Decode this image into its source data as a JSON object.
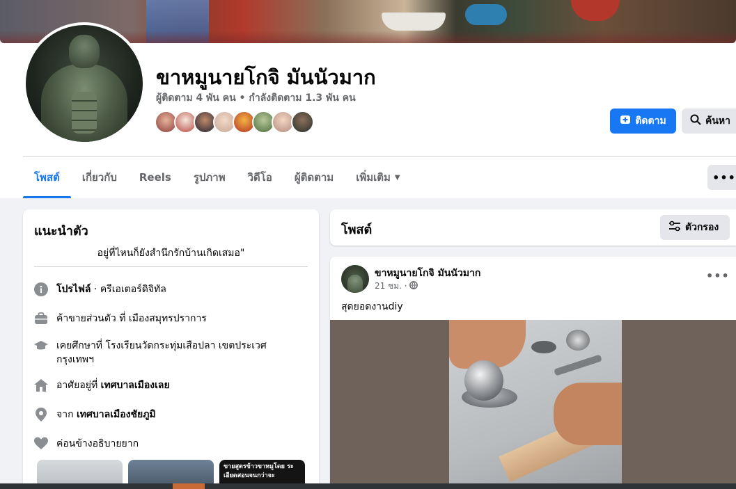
{
  "page": {
    "name": "ขาหมูนายโกจิ มันนัวมาก",
    "followers": "ผู้ติดตาม 4 พัน คน • กำลังติดตาม 1.3 พัน คน"
  },
  "buttons": {
    "follow": "ติดตาม",
    "search": "ค้นหา",
    "more": "•••"
  },
  "tabs": [
    {
      "label": "โพสต์"
    },
    {
      "label": "เกี่ยวกับ"
    },
    {
      "label": "Reels"
    },
    {
      "label": "รูปภาพ"
    },
    {
      "label": "วิดีโอ"
    },
    {
      "label": "ผู้ติดตาม"
    },
    {
      "label": "เพิ่มเติม"
    }
  ],
  "intro": {
    "title": "แนะนำตัว",
    "bio": "อยู่ที่ไหนก็ยังสำนึกรักบ้านเกิดเสมอ\"",
    "profile_label": "โปรไฟล์",
    "profile_value": " · ครีเอเตอร์ดิจิทัล",
    "work": "ค้าขายส่วนตัว ที่ เมืองสมุทรปราการ",
    "education": "เคยศึกษาที่ โรงเรียนวัดกระทุ่มเสือปลา เขตประเวศ กรุงเทพฯ",
    "lives_prefix": "อาศัยอยู่ที่ ",
    "lives_place": "เทศบาลเมืองเลย",
    "from_prefix": "จาก ",
    "from_place": "เทศบาลเมืองชัยภูมิ",
    "relationship": "ค่อนข้างอธิบายยาก",
    "photo3_text": "ขายสูตรข้าวขาหมูโดย ระเอียดสอนจนกว่าจะ"
  },
  "posts": {
    "title": "โพสต์",
    "filter": "ตัวกรอง"
  },
  "post": {
    "author": "ขาหมูนายโกจิ มันนัวมาก",
    "time": "21 ชม. ·",
    "text": "สุดยอดงานdiy",
    "menu": "•••"
  },
  "colors": {
    "accent": "#1877f2",
    "page_bg": "#f0f2f5",
    "secondary_text": "#65676b"
  },
  "icons": {
    "follow": "follow-plus-icon",
    "search": "search-icon",
    "filter": "sliders-icon",
    "globe": "globe-icon",
    "info": "info-icon",
    "work": "briefcase-icon",
    "education": "graduation-cap-icon",
    "home": "home-icon",
    "location": "map-pin-icon",
    "heart": "heart-icon"
  }
}
